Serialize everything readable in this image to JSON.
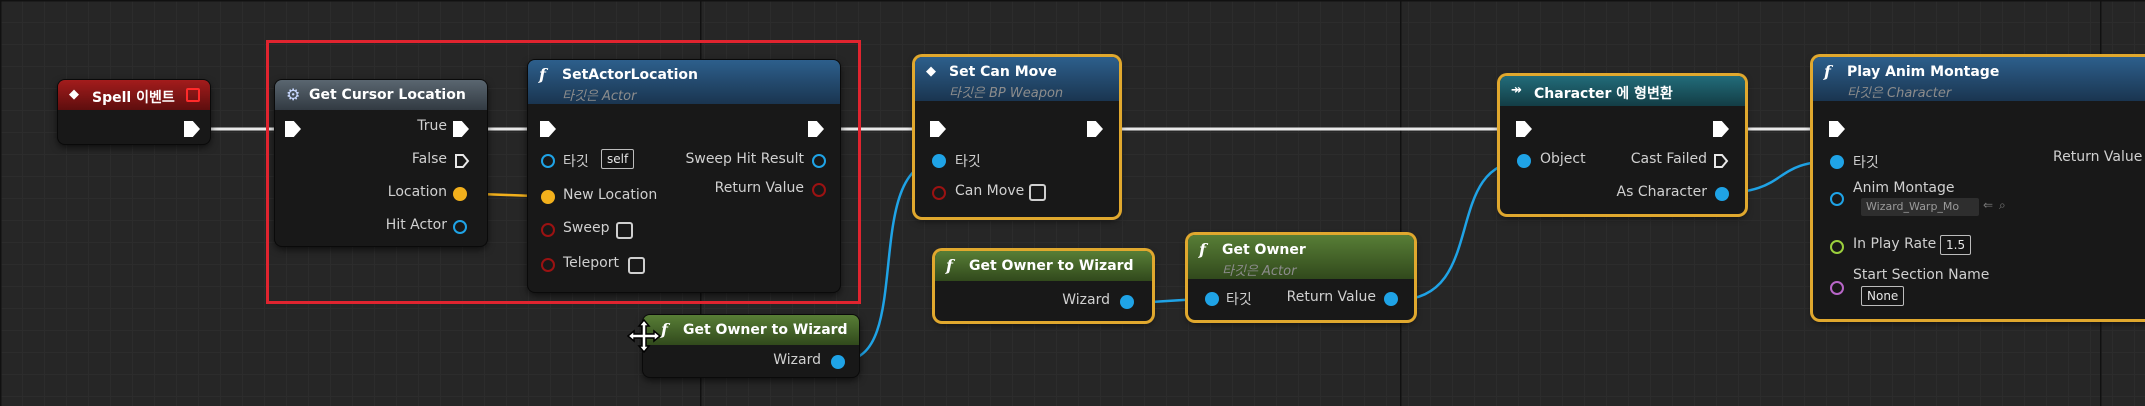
{
  "colors": {
    "event_header": "#8c1515",
    "pure_header": "#48545e",
    "function_header": "#264e74",
    "pure_function_header": "#476e28",
    "cast_header": "#1c5a66",
    "selection": "#e0a82e",
    "annotation_box": "#e0242f",
    "object_pin": "#1fa3e6",
    "vector_pin": "#f2b01c",
    "bool_pin": "#9b1212",
    "float_pin": "#9bcf3d",
    "name_pin": "#b866c8"
  },
  "nodes": {
    "event": {
      "title": "Spell 이벤트",
      "icon": "event-diamond-icon"
    },
    "cursor": {
      "title": "Get Cursor Location",
      "icon": "gear-icon",
      "outputs": [
        "True",
        "False",
        "Location",
        "Hit Actor"
      ]
    },
    "setloc": {
      "title": "SetActorLocation",
      "subtitle": "타깃은 Actor",
      "icon": "function-icon",
      "inputs": {
        "target": "타깃",
        "target_value": "self",
        "new_location": "New Location",
        "sweep": "Sweep",
        "teleport": "Teleport"
      },
      "outputs": {
        "sweep_hit": "Sweep Hit Result",
        "return_value": "Return Value"
      }
    },
    "setcanmove": {
      "title": "Set Can Move",
      "subtitle": "타깃은 BP Weapon",
      "icon": "setter-icon",
      "inputs": {
        "target": "타깃",
        "can_move": "Can Move"
      }
    },
    "gow1": {
      "title": "Get Owner to Wizard",
      "icon": "function-icon",
      "output": "Wizard"
    },
    "gow2": {
      "title": "Get Owner to Wizard",
      "icon": "function-icon",
      "output": "Wizard"
    },
    "getowner": {
      "title": "Get Owner",
      "subtitle": "타깃은 Actor",
      "icon": "function-icon",
      "input": "타깃",
      "output": "Return Value"
    },
    "cast": {
      "title": "Character 에 형변환",
      "icon": "cast-icon",
      "input": "Object",
      "outputs": {
        "cast_failed": "Cast Failed",
        "as_character": "As Character"
      }
    },
    "montage": {
      "title": "Play Anim Montage",
      "subtitle": "타깃은 Character",
      "icon": "function-icon",
      "inputs": {
        "target": "타깃",
        "anim_montage": "Anim Montage",
        "anim_montage_value": "Wizard_Warp_Mo",
        "in_play_rate": "In Play Rate",
        "in_play_rate_value": "1.5",
        "start_section": "Start Section Name",
        "start_section_value": "None"
      },
      "output": "Return Value"
    }
  }
}
